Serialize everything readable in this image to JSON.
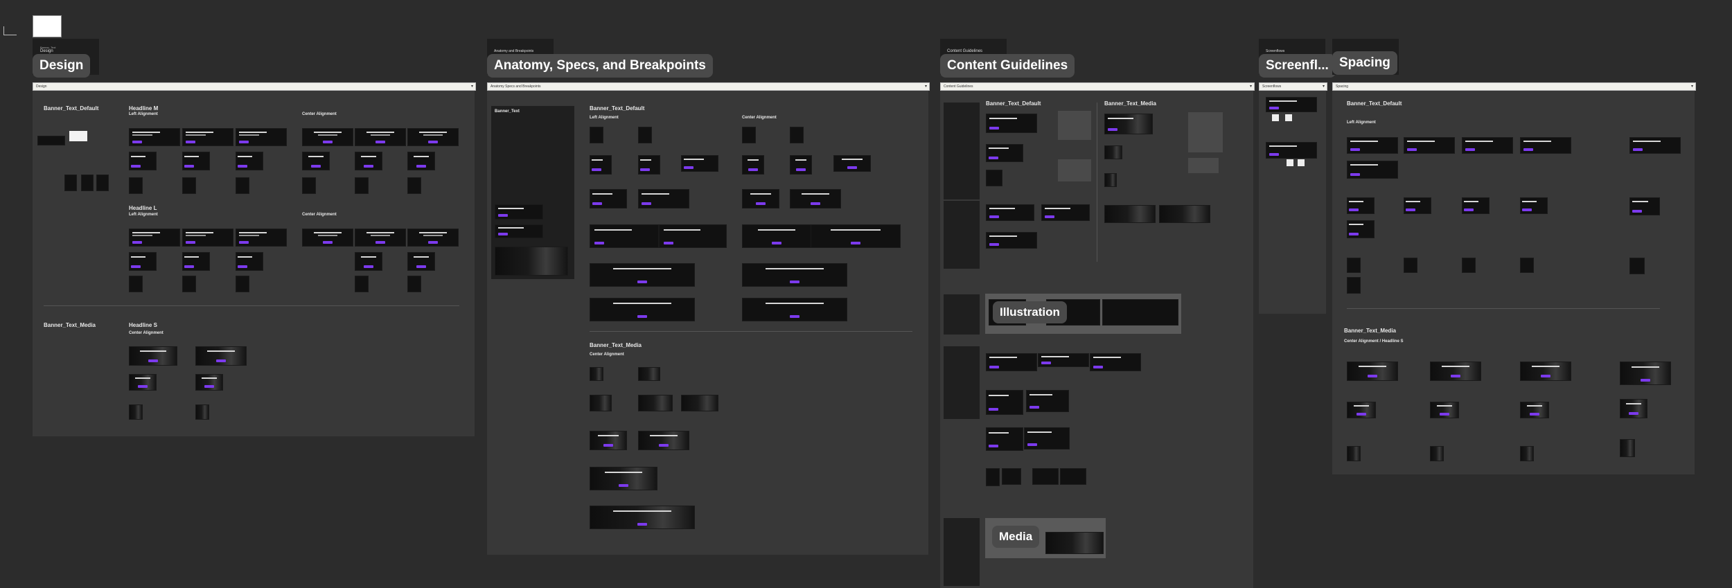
{
  "canvas": {
    "background": "#2c2c2c",
    "accent": "#7c3aed",
    "thumbnail_icon": "page-thumbnail-icon"
  },
  "sections": {
    "design": {
      "title": "Design",
      "cover_small_1": "Banner_Text",
      "cover_small_2": "Design",
      "topbar": "Design",
      "default_title": "Banner_Text_Default",
      "headline_m": "Headline M",
      "headline_l": "Headline L",
      "headline_s": "Headline S",
      "left_alignment": "Left Alignment",
      "center_alignment": "Center Alignment",
      "media_title": "Banner_Text_Media"
    },
    "anatomy": {
      "title": "Anatomy, Specs, and Breakpoints",
      "cover_small": "Anatomy and Breakpoints",
      "topbar": "Anatomy Specs and Breakpoints",
      "sidebar_title": "Banner_Text",
      "default_title": "Banner_Text_Default",
      "left_alignment": "Left Alignment",
      "center_alignment": "Center Alignment",
      "media_title": "Banner_Text_Media",
      "media_center": "Center Alignment"
    },
    "content": {
      "title": "Content Guidelines",
      "cover_small": "Content Guidelines",
      "topbar": "Content Guidelines",
      "default_title": "Banner_Text_Default",
      "media_title": "Banner_Text_Media",
      "illustration": "Illustration",
      "media": "Media"
    },
    "screenflows": {
      "title": "Screenfl...",
      "cover_small": "Screenflows",
      "topbar": "Screenflows"
    },
    "spacing": {
      "title": "Spacing",
      "topbar": "Spacing",
      "default_title": "Banner_Text_Default",
      "left_alignment": "Left Alignment",
      "media_title": "Banner_Text_Media",
      "media_sub": "Center Alignment / Headline S"
    }
  }
}
